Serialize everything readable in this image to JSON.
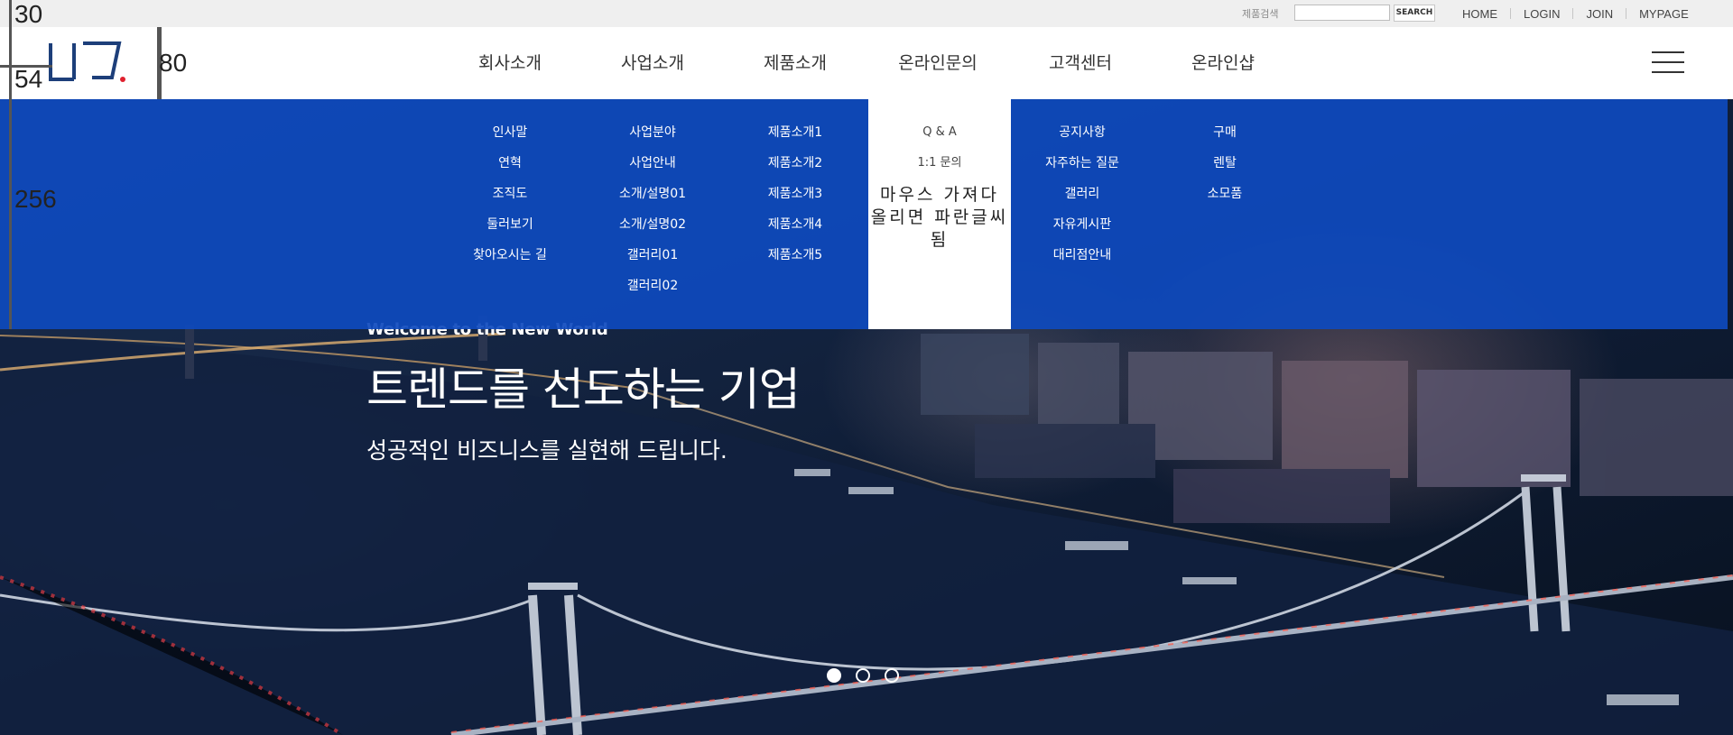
{
  "topbar": {
    "search_label": "제품검색",
    "search_value": "",
    "search_button": "SEARCH",
    "links": [
      "HOME",
      "LOGIN",
      "JOIN",
      "MYPAGE"
    ]
  },
  "guides": {
    "n1": "30",
    "n2": "54",
    "n3": "80",
    "n4": "256"
  },
  "nav": {
    "items": [
      "회사소개",
      "사업소개",
      "제품소개",
      "온라인문의",
      "고객센터",
      "온라인샵"
    ],
    "active_index": 3
  },
  "submenu": {
    "company": [
      "인사말",
      "연혁",
      "조직도",
      "둘러보기",
      "찾아오시는 길"
    ],
    "business": [
      "사업분야",
      "사업안내",
      "소개/설명01",
      "소개/설명02",
      "갤러리01",
      "갤러리02"
    ],
    "products": [
      "제품소개1",
      "제품소개2",
      "제품소개3",
      "제품소개4",
      "제품소개5"
    ],
    "inquiry": [
      "Q & A",
      "1:1 문의"
    ],
    "inquiry_note": "마우스 가져다 올리면 파란글씨됨",
    "support": [
      "공지사항",
      "자주하는 질문",
      "갤러리",
      "자유게시판",
      "대리점안내"
    ],
    "shop": [
      "구매",
      "렌탈",
      "소모품"
    ]
  },
  "hero": {
    "eyebrow": "Welcome to the New World",
    "title": "트렌드를 선도하는 기업",
    "subtitle": "성공적인 비즈니스를 실현해 드립니다."
  },
  "slider": {
    "count": 3,
    "active": 0
  },
  "colors": {
    "dropdown_blue": "#0e4abe",
    "logo_navy": "#1d3f7a",
    "logo_dot": "#e0202e"
  }
}
